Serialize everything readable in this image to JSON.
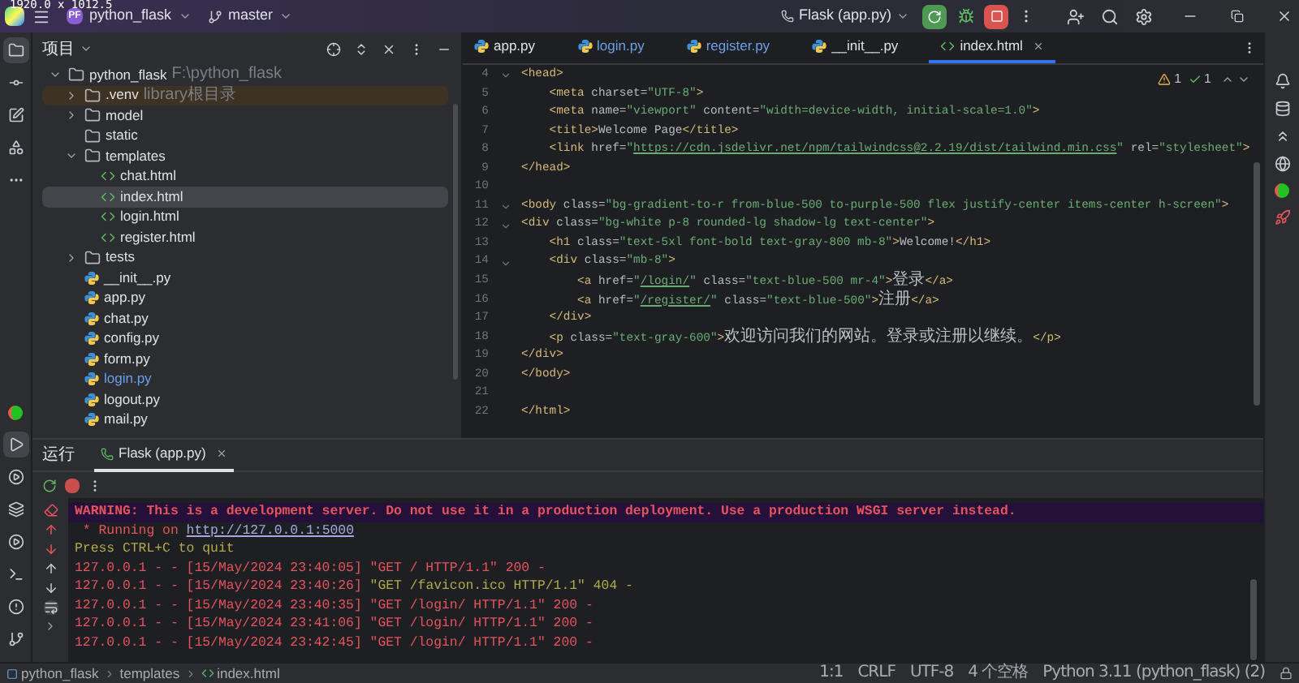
{
  "overlay_text": "1920.0 x 1012.5",
  "title_bar": {
    "project_badge": "PF",
    "project": "python_flask",
    "branch": "master",
    "run_config": "Flask (app.py)"
  },
  "tool_strip_top": [
    {
      "selected": true
    },
    {
      "selected": false
    },
    {
      "selected": false
    },
    {
      "selected": false
    },
    {
      "selected": false
    }
  ],
  "tool_strip_bottom": [
    {
      "selected": false
    },
    {
      "selected": true
    },
    {
      "selected": false
    },
    {
      "selected": false
    },
    {
      "selected": false
    },
    {
      "selected": false
    },
    {
      "selected": false
    },
    {
      "selected": false
    }
  ],
  "project_panel": {
    "title": "项目",
    "tree": [
      {
        "name": "python_flask",
        "hint": "F:\\python_flask",
        "kind": "folder",
        "expanded": true,
        "selected": false,
        "excluded": false,
        "modified": false,
        "children": [
          {
            "name": ".venv",
            "hint": "library根目录",
            "kind": "folder",
            "expanded": false,
            "selected": false,
            "excluded": true,
            "modified": false
          },
          {
            "name": "model",
            "kind": "folder",
            "expanded": false,
            "selected": false,
            "excluded": false,
            "modified": false
          },
          {
            "name": "static",
            "kind": "empty-folder",
            "selected": false,
            "excluded": false,
            "modified": false
          },
          {
            "name": "templates",
            "kind": "folder",
            "expanded": true,
            "selected": false,
            "excluded": false,
            "modified": false,
            "children": [
              {
                "name": "chat.html",
                "kind": "html",
                "selected": false,
                "excluded": false,
                "modified": false
              },
              {
                "name": "index.html",
                "kind": "html",
                "selected": true,
                "excluded": false,
                "modified": false
              },
              {
                "name": "login.html",
                "kind": "html",
                "selected": false,
                "excluded": false,
                "modified": false
              },
              {
                "name": "register.html",
                "kind": "html",
                "selected": false,
                "excluded": false,
                "modified": false
              }
            ]
          },
          {
            "name": "tests",
            "kind": "folder",
            "expanded": false,
            "selected": false,
            "excluded": false,
            "modified": false
          },
          {
            "name": "__init__.py",
            "kind": "python",
            "selected": false,
            "excluded": false,
            "modified": false
          },
          {
            "name": "app.py",
            "kind": "python",
            "selected": false,
            "excluded": false,
            "modified": false
          },
          {
            "name": "chat.py",
            "kind": "python",
            "selected": false,
            "excluded": false,
            "modified": false
          },
          {
            "name": "config.py",
            "kind": "python",
            "selected": false,
            "excluded": false,
            "modified": false
          },
          {
            "name": "form.py",
            "kind": "python",
            "selected": false,
            "excluded": false,
            "modified": false
          },
          {
            "name": "login.py",
            "kind": "python",
            "selected": false,
            "excluded": false,
            "modified": true
          },
          {
            "name": "logout.py",
            "kind": "python",
            "selected": false,
            "excluded": false,
            "modified": false
          },
          {
            "name": "mail.py",
            "kind": "python",
            "selected": false,
            "excluded": false,
            "modified": false
          }
        ]
      }
    ]
  },
  "editor_tabs": [
    {
      "label": "app.py",
      "kind": "python",
      "selected": false,
      "modified": false
    },
    {
      "label": "login.py",
      "kind": "python",
      "selected": false,
      "modified": true
    },
    {
      "label": "register.py",
      "kind": "python",
      "selected": false,
      "modified": true
    },
    {
      "label": "__init__.py",
      "kind": "python",
      "selected": false,
      "modified": false
    },
    {
      "label": "index.html",
      "kind": "html",
      "selected": true,
      "modified": false
    }
  ],
  "inspections": {
    "warnings": "1",
    "weak_warnings": "1"
  },
  "code_lines": [
    {
      "number": "4",
      "fold": true,
      "tokens": [
        {
          "kind": "tag",
          "text": "<head>"
        }
      ]
    },
    {
      "number": "5",
      "fold": false,
      "tokens": [
        {
          "kind": "tag",
          "text": "    <meta "
        },
        {
          "kind": "attr",
          "text": "charset="
        },
        {
          "kind": "str",
          "text": "\"UTF-8\""
        },
        {
          "kind": "tag",
          "text": ">"
        }
      ]
    },
    {
      "number": "6",
      "fold": false,
      "tokens": [
        {
          "kind": "tag",
          "text": "    <meta "
        },
        {
          "kind": "attr",
          "text": "name="
        },
        {
          "kind": "str",
          "text": "\"viewport\""
        },
        {
          "kind": "attr",
          "text": " content="
        },
        {
          "kind": "str",
          "text": "\"width=device-width, initial-scale=1.0\""
        },
        {
          "kind": "tag",
          "text": ">"
        }
      ]
    },
    {
      "number": "7",
      "fold": false,
      "tokens": [
        {
          "kind": "tag",
          "text": "    <title>"
        },
        {
          "kind": "text",
          "text": "Welcome Page"
        },
        {
          "kind": "tag",
          "text": "</title>"
        }
      ]
    },
    {
      "number": "8",
      "fold": false,
      "tokens": [
        {
          "kind": "tag",
          "text": "    <link "
        },
        {
          "kind": "attr",
          "text": "href="
        },
        {
          "kind": "str",
          "text": "\""
        },
        {
          "kind": "link",
          "text": "https://cdn.jsdelivr.net/npm/tailwindcss@2.2.19/dist/tailwind.min.css"
        },
        {
          "kind": "str",
          "text": "\""
        },
        {
          "kind": "attr",
          "text": " rel="
        },
        {
          "kind": "str",
          "text": "\"stylesheet\""
        },
        {
          "kind": "tag",
          "text": ">"
        }
      ]
    },
    {
      "number": "9",
      "fold": false,
      "tokens": [
        {
          "kind": "tag",
          "text": "</head>"
        }
      ]
    },
    {
      "number": "10",
      "fold": false
    },
    {
      "number": "11",
      "fold": true,
      "tokens": [
        {
          "kind": "tag",
          "text": "<body "
        },
        {
          "kind": "attr",
          "text": "class="
        },
        {
          "kind": "str",
          "text": "\"bg-gradient-to-r from-blue-500 to-purple-500 flex justify-center items-center h-screen\""
        },
        {
          "kind": "tag",
          "text": ">"
        }
      ]
    },
    {
      "number": "12",
      "fold": true,
      "tokens": [
        {
          "kind": "tag",
          "text": "<div "
        },
        {
          "kind": "attr",
          "text": "class="
        },
        {
          "kind": "str",
          "text": "\"bg-white p-8 rounded-lg shadow-lg text-center\""
        },
        {
          "kind": "tag",
          "text": ">"
        }
      ]
    },
    {
      "number": "13",
      "fold": false,
      "tokens": [
        {
          "kind": "tag",
          "text": "    <h1 "
        },
        {
          "kind": "attr",
          "text": "class="
        },
        {
          "kind": "str",
          "text": "\"text-5xl font-bold text-gray-800 mb-8\""
        },
        {
          "kind": "tag",
          "text": ">"
        },
        {
          "kind": "text",
          "text": "Welcome!"
        },
        {
          "kind": "tag",
          "text": "</h1>"
        }
      ]
    },
    {
      "number": "14",
      "fold": true,
      "tokens": [
        {
          "kind": "tag",
          "text": "    <div "
        },
        {
          "kind": "attr",
          "text": "class="
        },
        {
          "kind": "str",
          "text": "\"mb-8\""
        },
        {
          "kind": "tag",
          "text": ">"
        }
      ]
    },
    {
      "number": "15",
      "fold": false,
      "tokens": [
        {
          "kind": "tag",
          "text": "        <a "
        },
        {
          "kind": "attr",
          "text": "href="
        },
        {
          "kind": "str",
          "text": "\""
        },
        {
          "kind": "link",
          "text": "/login/"
        },
        {
          "kind": "str",
          "text": "\""
        },
        {
          "kind": "attr",
          "text": " class="
        },
        {
          "kind": "str",
          "text": "\"text-blue-500 mr-4\""
        },
        {
          "kind": "tag",
          "text": ">"
        },
        {
          "kind": "cjk",
          "text": "登录"
        },
        {
          "kind": "tag",
          "text": "</a>"
        }
      ]
    },
    {
      "number": "16",
      "fold": false,
      "tokens": [
        {
          "kind": "tag",
          "text": "        <a "
        },
        {
          "kind": "attr",
          "text": "href="
        },
        {
          "kind": "str",
          "text": "\""
        },
        {
          "kind": "link",
          "text": "/register/"
        },
        {
          "kind": "str",
          "text": "\""
        },
        {
          "kind": "attr",
          "text": " class="
        },
        {
          "kind": "str",
          "text": "\"text-blue-500\""
        },
        {
          "kind": "tag",
          "text": ">"
        },
        {
          "kind": "cjk",
          "text": "注册"
        },
        {
          "kind": "tag",
          "text": "</a>"
        }
      ]
    },
    {
      "number": "17",
      "fold": false,
      "tokens": [
        {
          "kind": "tag",
          "text": "    </div>"
        }
      ]
    },
    {
      "number": "18",
      "fold": false,
      "tokens": [
        {
          "kind": "tag",
          "text": "    <p "
        },
        {
          "kind": "attr",
          "text": "class="
        },
        {
          "kind": "str",
          "text": "\"text-gray-600\""
        },
        {
          "kind": "tag",
          "text": ">"
        },
        {
          "kind": "cjk",
          "text": "欢迎访问我们的网站。登录或注册以继续。"
        },
        {
          "kind": "tag",
          "text": "</p>"
        }
      ]
    },
    {
      "number": "19",
      "fold": false,
      "tokens": [
        {
          "kind": "tag",
          "text": "</div>"
        }
      ]
    },
    {
      "number": "20",
      "fold": false,
      "tokens": [
        {
          "kind": "tag",
          "text": "</body>"
        }
      ]
    },
    {
      "number": "21",
      "fold": false
    },
    {
      "number": "22",
      "fold": false,
      "tokens": [
        {
          "kind": "tag",
          "text": "</html>"
        }
      ]
    }
  ],
  "bottom_panel": {
    "title": "运行",
    "tabs": [
      {
        "label": "Flask (app.py)",
        "selected": true
      }
    ],
    "console": [
      {
        "kind": "warning",
        "tokens": [
          {
            "kind": "red",
            "text": "WARNING: This is a development server. Do not use it in a production deployment. Use a production WSGI server instead."
          }
        ]
      },
      {
        "kind": "normal",
        "tokens": [
          {
            "kind": "red",
            "text": " * Running on "
          },
          {
            "kind": "link",
            "text": "http://127.0.0.1:5000"
          }
        ]
      },
      {
        "kind": "normal",
        "tokens": [
          {
            "kind": "olive",
            "text": "Press CTRL+C to quit"
          }
        ]
      },
      {
        "kind": "normal",
        "tokens": [
          {
            "kind": "red",
            "text": "127.0.0.1 - - [15/May/2024 23:40:05] \"GET / HTTP/1.1\" 200 -"
          }
        ]
      },
      {
        "kind": "normal",
        "tokens": [
          {
            "kind": "red",
            "text": "127.0.0.1 - - [15/May/2024 23:40:26] "
          },
          {
            "kind": "olive",
            "text": "\"GET /favicon.ico HTTP/1.1\" 404 -"
          }
        ]
      },
      {
        "kind": "normal",
        "tokens": [
          {
            "kind": "red",
            "text": "127.0.0.1 - - [15/May/2024 23:40:35] \"GET /login/ HTTP/1.1\" 200 -"
          }
        ]
      },
      {
        "kind": "normal",
        "tokens": [
          {
            "kind": "red",
            "text": "127.0.0.1 - - [15/May/2024 23:41:06] \"GET /login/ HTTP/1.1\" 200 -"
          }
        ]
      },
      {
        "kind": "normal",
        "tokens": [
          {
            "kind": "red",
            "text": "127.0.0.1 - - [15/May/2024 23:42:45] \"GET /login/ HTTP/1.1\" 200 -"
          }
        ]
      }
    ]
  },
  "status_bar": {
    "breadcrumbs": [
      "python_flask",
      "templates",
      "index.html"
    ],
    "items": [
      "1:1",
      "CRLF",
      "UTF-8",
      "4 个空格",
      "Python 3.11 (python_flask) (2)"
    ]
  }
}
